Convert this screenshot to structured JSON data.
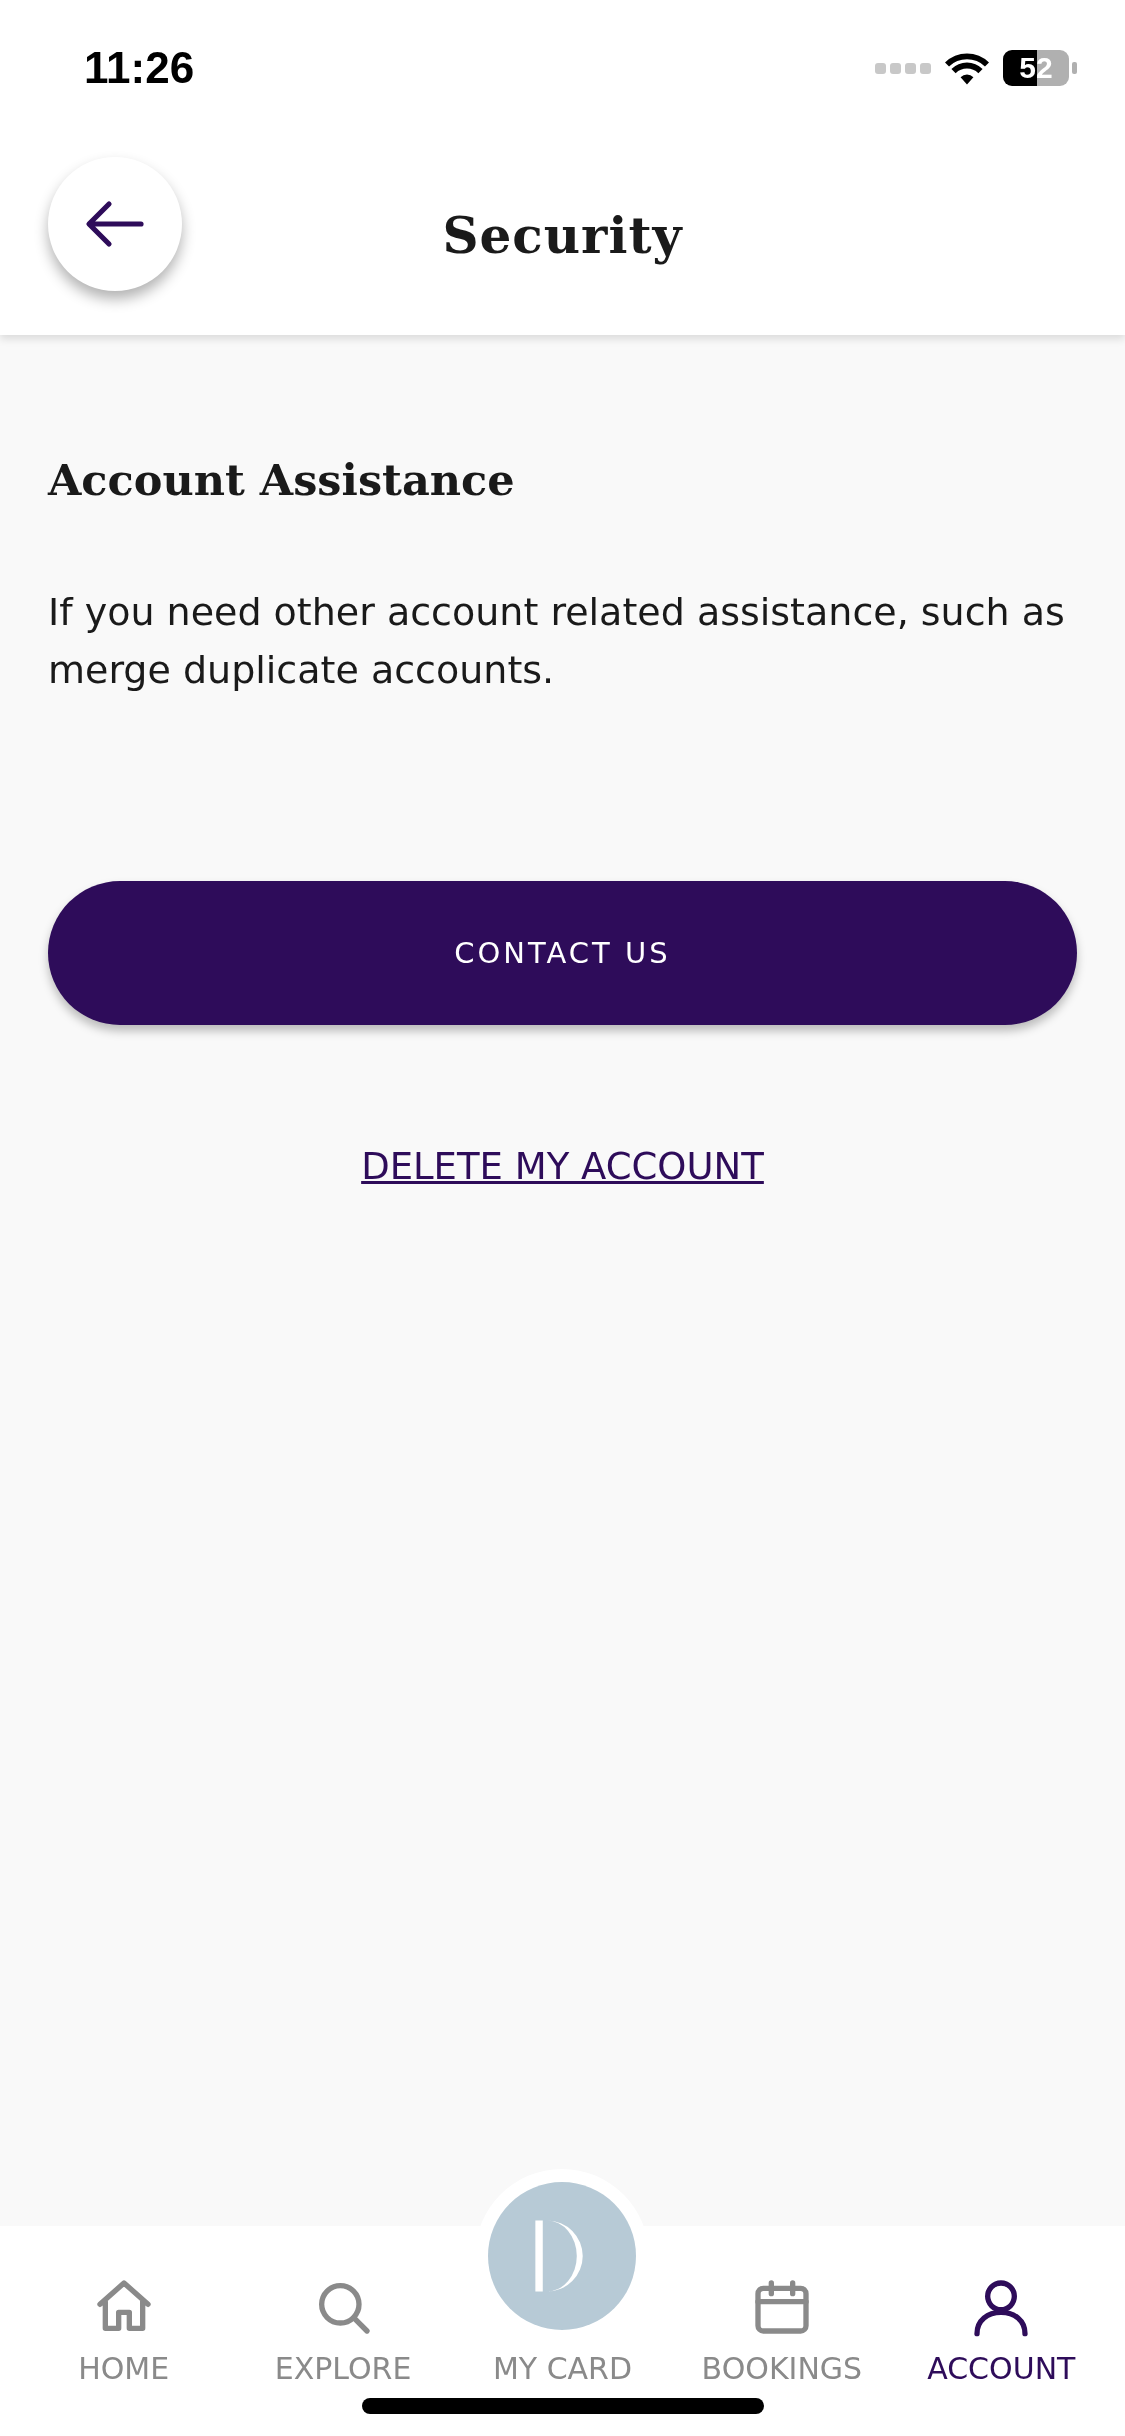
{
  "status_bar": {
    "time": "11:26",
    "battery": "52"
  },
  "header": {
    "title": "Security"
  },
  "section": {
    "title": "Account Assistance",
    "description": "If you need other account related assistance, such as merge duplicate accounts."
  },
  "primary_button": {
    "label": "CONTACT US"
  },
  "link": {
    "label": "DELETE MY ACCOUNT"
  },
  "tab_bar": [
    {
      "kind": "home",
      "label": "HOME",
      "selected": false
    },
    {
      "kind": "explore",
      "label": "EXPLORE",
      "selected": false
    },
    {
      "kind": "card",
      "label": "MY CARD",
      "selected": false
    },
    {
      "kind": "bookings",
      "label": "BOOKINGS",
      "selected": false
    },
    {
      "kind": "account",
      "label": "ACCOUNT",
      "selected": true
    }
  ]
}
